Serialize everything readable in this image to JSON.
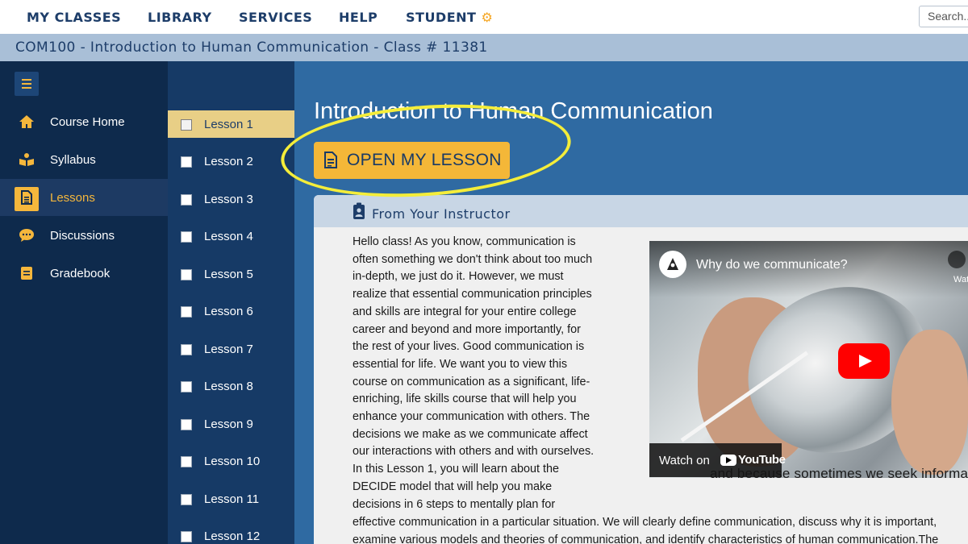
{
  "nav": {
    "items": [
      "MY CLASSES",
      "LIBRARY",
      "SERVICES",
      "HELP",
      "STUDENT"
    ],
    "search_placeholder": "Search..."
  },
  "course": {
    "title": "COM100 - Introduction to Human Communication - Class # 11381"
  },
  "sidebar": {
    "items": [
      {
        "label": "Course Home",
        "icon": "home-icon"
      },
      {
        "label": "Syllabus",
        "icon": "syllabus-icon"
      },
      {
        "label": "Lessons",
        "icon": "lessons-icon",
        "active": true
      },
      {
        "label": "Discussions",
        "icon": "discussions-icon"
      },
      {
        "label": "Gradebook",
        "icon": "gradebook-icon"
      }
    ]
  },
  "lessons": {
    "items": [
      "Lesson 1",
      "Lesson 2",
      "Lesson 3",
      "Lesson 4",
      "Lesson 5",
      "Lesson 6",
      "Lesson 7",
      "Lesson 8",
      "Lesson 9",
      "Lesson 10",
      "Lesson 11",
      "Lesson 12"
    ],
    "active_index": 0
  },
  "main": {
    "title": "Introduction to Human Communication",
    "open_button_label": "OPEN MY LESSON",
    "panel_title": "From Your Instructor",
    "body_lines": [
      "Hello class!  As you know, communication is",
      "often something we don't think about too much",
      "in-depth, we just do it.  However, we must",
      "realize that essential communication principles",
      "and skills are integral for your entire college",
      "career and beyond and more importantly, for",
      "the rest of your lives.  Good communication is",
      "essential for life.  We want you to view this",
      "course on communication as a significant, life-",
      "enriching, life skills course that will help you",
      "enhance your communication with others.  The",
      "decisions we make as we communicate affect",
      "our interactions with others and with ourselves.",
      " In this Lesson 1, you will learn about the",
      "DECIDE model that will help you make",
      "decisions in 6 steps to mentally plan for"
    ],
    "wide_lines": [
      "effective communication in a particular situation. We will clearly define  communication, discuss why it is important,",
      "examine various models and theories of communication, and identify characteristics of human communication.The"
    ]
  },
  "video": {
    "title": "Why do we communicate?",
    "watch_later_label": "Watch",
    "watch_on_label": "Watch on",
    "youtube_label": "YouTube",
    "caption": "and because sometimes we  seek information"
  },
  "colors": {
    "navy": "#0e2a4c",
    "lesson_column": "#163a66",
    "main_blue": "#2f6aa2",
    "accent_gold": "#f4b738",
    "highlight_yellow": "#f4ed3a"
  }
}
